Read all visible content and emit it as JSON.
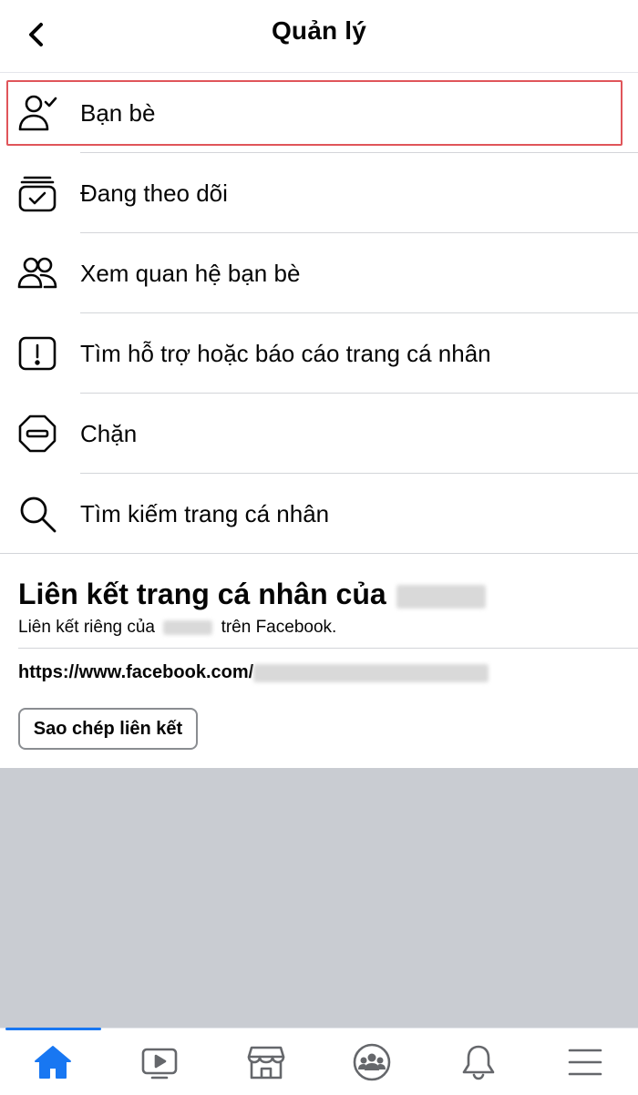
{
  "header": {
    "title": "Quản lý",
    "back_icon": "chevron-left-icon"
  },
  "menu": {
    "items": [
      {
        "label": "Bạn bè",
        "icon": "friend-check-icon"
      },
      {
        "label": "Đang theo dõi",
        "icon": "following-stack-icon"
      },
      {
        "label": "Xem quan hệ bạn bè",
        "icon": "friends-pair-icon"
      },
      {
        "label": "Tìm hỗ trợ hoặc báo cáo trang cá nhân",
        "icon": "report-exclamation-icon"
      },
      {
        "label": "Chặn",
        "icon": "block-octagon-icon"
      },
      {
        "label": "Tìm kiếm trang cá nhân",
        "icon": "search-icon"
      }
    ]
  },
  "profile_link": {
    "title": "Liên kết trang cá nhân của",
    "subtitle_prefix": "Liên kết riêng của",
    "subtitle_suffix": "trên Facebook.",
    "url": "https://www.facebook.com/",
    "copy_label": "Sao chép liên kết"
  },
  "tabbar": {
    "tabs": [
      {
        "name": "home",
        "icon": "home-icon",
        "active": true
      },
      {
        "name": "watch",
        "icon": "video-icon",
        "active": false
      },
      {
        "name": "marketplace",
        "icon": "marketplace-icon",
        "active": false
      },
      {
        "name": "groups",
        "icon": "groups-icon",
        "active": false
      },
      {
        "name": "notifications",
        "icon": "bell-icon",
        "active": false
      },
      {
        "name": "menu",
        "icon": "menu-icon",
        "active": false
      }
    ]
  },
  "colors": {
    "accent": "#1877f2",
    "highlight_border": "#e0555a",
    "background_gray": "#c9ccd2",
    "divider": "#d3d5d9"
  }
}
